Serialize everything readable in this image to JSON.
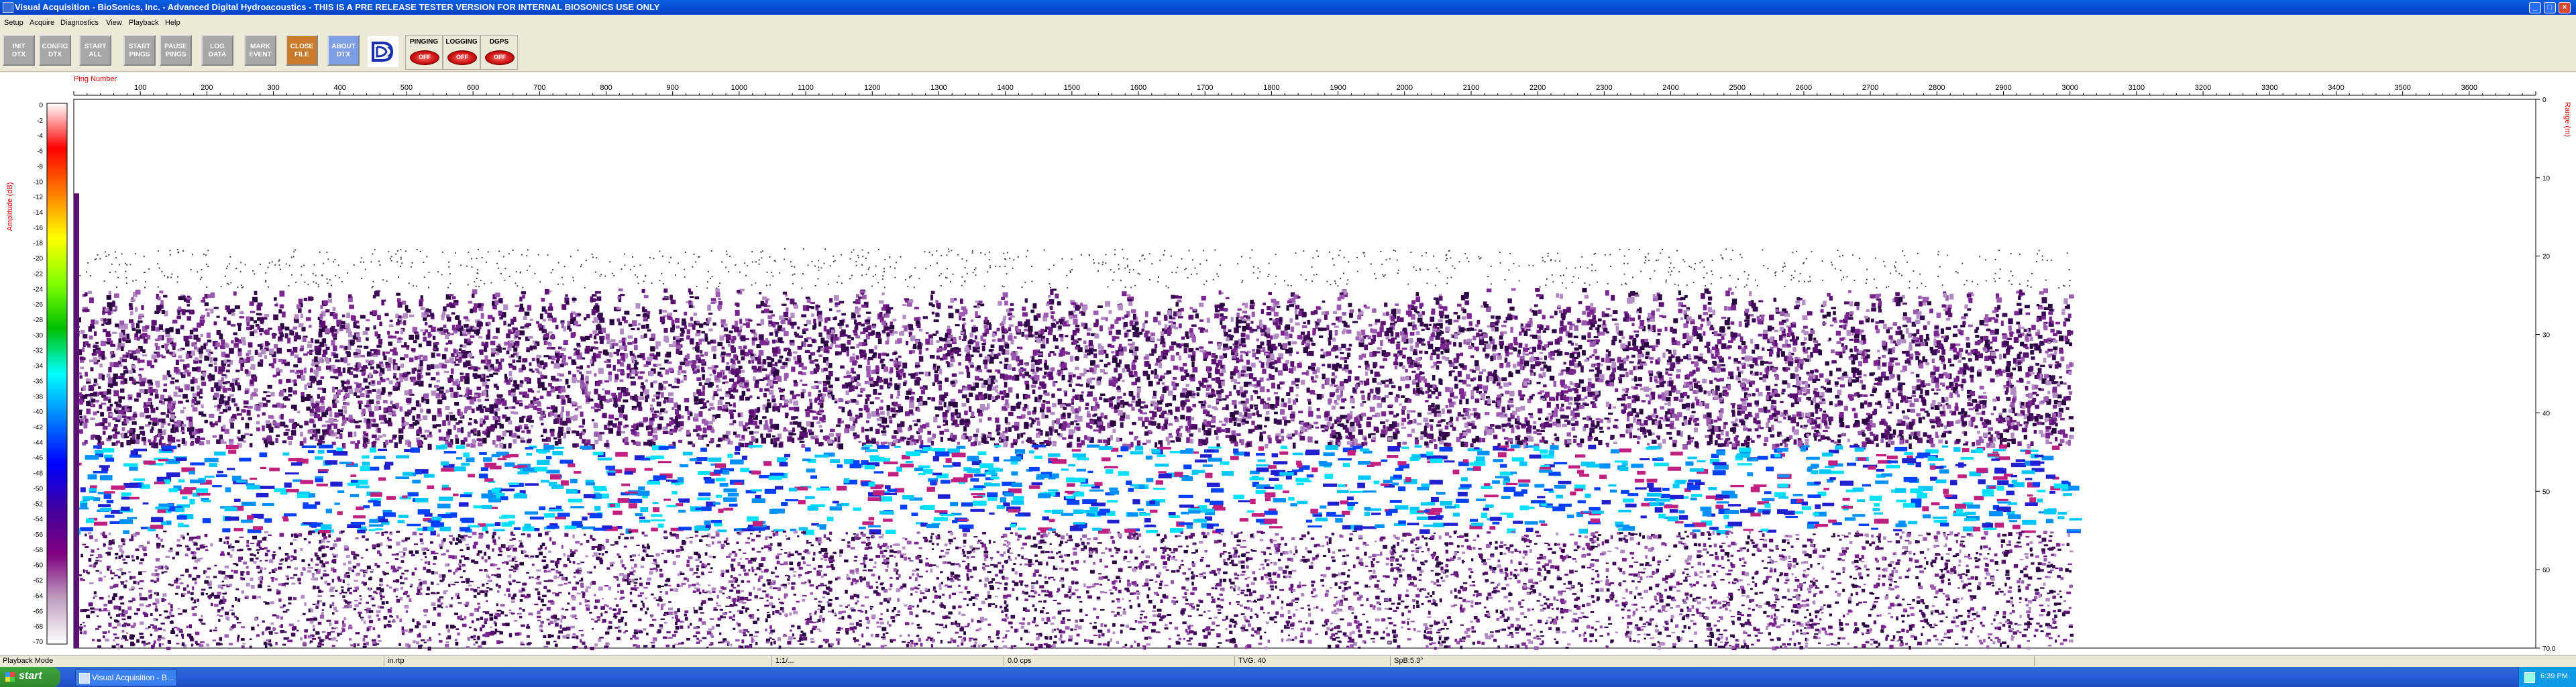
{
  "window": {
    "title": "Visual Acquisition  -  BioSonics, Inc.  -  Advanced Digital Hydroacoustics  -  THIS IS A PRE RELEASE TESTER VERSION FOR INTERNAL BIOSONICS USE ONLY"
  },
  "menu": [
    "Setup",
    "Acquire",
    "Diagnostics",
    "View",
    "Playback",
    "Help"
  ],
  "toolbar": {
    "buttons": [
      {
        "l1": "INIT",
        "l2": "DTX"
      },
      {
        "l1": "CONFIG",
        "l2": "DTX"
      },
      {
        "l1": "START",
        "l2": "ALL"
      },
      {
        "l1": "START",
        "l2": "PINGS"
      },
      {
        "l1": "PAUSE",
        "l2": "PINGS"
      },
      {
        "l1": "LOG",
        "l2": "DATA"
      },
      {
        "l1": "MARK",
        "l2": "EVENT"
      },
      {
        "l1": "CLOSE",
        "l2": "FILE"
      },
      {
        "l1": "ABOUT",
        "l2": "DTX"
      }
    ],
    "indicators": [
      {
        "label": "PINGING",
        "led": "OFF"
      },
      {
        "label": "LOGGING",
        "led": "OFF"
      },
      {
        "label": "DGPS",
        "led": "OFF"
      }
    ],
    "colors": {
      "button": "#a7a7a7",
      "close": "#c87b2a",
      "about": "#7e9fe6"
    }
  },
  "echogram": {
    "x_axis_label": "Ping Number",
    "y_axis_left_label": "Amplitude (dB)",
    "y_axis_right_label": "Range (m)",
    "ping_ticks": [
      "100",
      "200",
      "300",
      "400",
      "500",
      "600",
      "700",
      "800",
      "900",
      "1000",
      "1100",
      "1200",
      "1300",
      "1400",
      "1500",
      "1600",
      "1700",
      "1800",
      "1900",
      "2000",
      "2100",
      "2200",
      "2300",
      "2400",
      "2500",
      "2600",
      "2700",
      "2800",
      "2900",
      "3000",
      "3100",
      "3200",
      "3300",
      "3400",
      "3500",
      "3600"
    ],
    "ping_range": [
      0,
      3700
    ],
    "data_end_ping": 3000,
    "amplitude_ticks": [
      "0",
      "-2",
      "-4",
      "-6",
      "-8",
      "-10",
      "-12",
      "-14",
      "-16",
      "-18",
      "-20",
      "-22",
      "-24",
      "-26",
      "-28",
      "-30",
      "-32",
      "-34",
      "-36",
      "-38",
      "-40",
      "-42",
      "-44",
      "-46",
      "-48",
      "-50",
      "-52",
      "-54",
      "-56",
      "-58",
      "-60",
      "-62",
      "-64",
      "-66",
      "-68",
      "-70"
    ],
    "amplitude_range": [
      0,
      -70
    ],
    "range_ticks": [
      "0",
      "10",
      "20",
      "30",
      "40",
      "50",
      "60",
      "70.0"
    ],
    "range_max_m": 70,
    "bottom_band_range_m": [
      44,
      55
    ],
    "colorbar_colors": [
      "#ffffff",
      "#ff0000",
      "#ff8000",
      "#ffff00",
      "#80ff00",
      "#00c000",
      "#00ffff",
      "#0080ff",
      "#0000ff",
      "#4000a0",
      "#800080",
      "#c0a0c0",
      "#ffffff"
    ]
  },
  "statusbar": {
    "mode": "Playback Mode",
    "file": "in.rtp",
    "time": "1:1/...",
    "pulse": "0.0 cps",
    "tvg": "TVG: 40",
    "sp": "SpB:5.3°"
  },
  "taskbar": {
    "start": "start",
    "task": "Visual Acquisition - B...",
    "clock": "6:39 PM"
  }
}
